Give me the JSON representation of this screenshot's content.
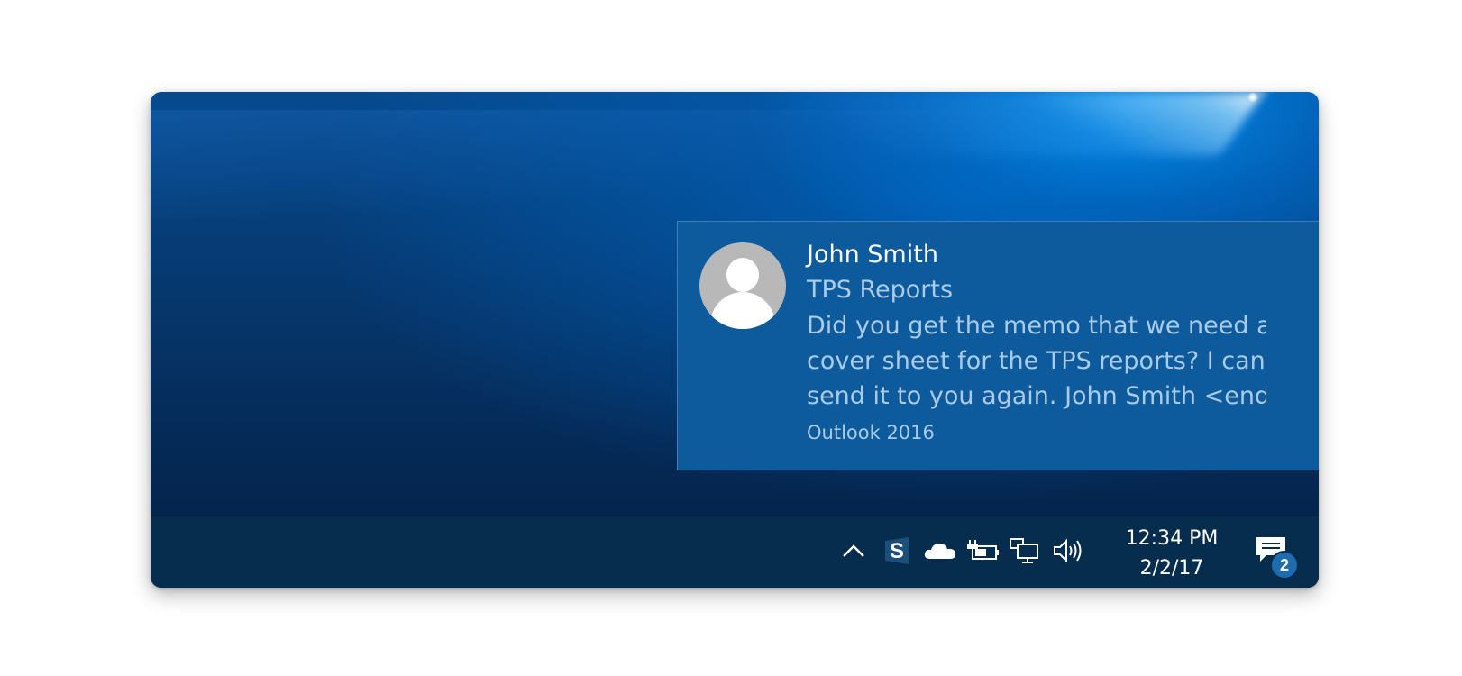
{
  "notification": {
    "sender": "John Smith",
    "subject": "TPS Reports",
    "body_lines": [
      "Did you get the memo that we need a",
      "cover sheet for the TPS reports? I can",
      "send it to you again.  John Smith <end"
    ],
    "app_name": "Outlook 2016",
    "background_color": "#0d5a9c"
  },
  "taskbar": {
    "background_color": "#062c4e",
    "tray_icons": [
      "chevron-up-icon",
      "s-app-icon",
      "onedrive-cloud-icon",
      "battery-power-icon",
      "network-icon",
      "volume-icon"
    ],
    "clock": {
      "time": "12:34 PM",
      "date": "2/2/17"
    },
    "action_center": {
      "icon": "action-center-icon",
      "badge_count": "2"
    }
  }
}
